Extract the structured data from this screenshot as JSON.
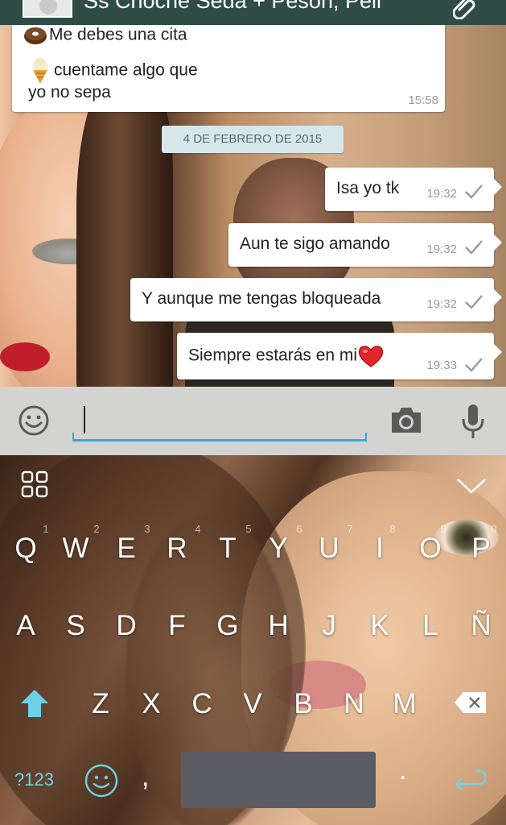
{
  "topbar": {
    "title": "Ss Choche Seda + Peson, Peli"
  },
  "messages": {
    "incoming": {
      "line1_emoji": "donut",
      "line1": "Me debes una cita",
      "line2_emoji": "ice-cream",
      "line2": "cuentame algo que",
      "line3": "yo no sepa",
      "time": "15:58"
    },
    "date": "4 DE FEBRERO DE 2015",
    "outgoing": [
      {
        "text": "Isa yo tk",
        "time": "19:32"
      },
      {
        "text": "Aun te sigo amando",
        "time": "19:32"
      },
      {
        "text": "Y aunque me tengas bloqueada",
        "time": "19:32"
      },
      {
        "text": "Siempre estarás en mi",
        "time": "19:33",
        "emoji": "heart"
      }
    ]
  },
  "compose": {
    "value": "",
    "placeholder": "",
    "accent_color": "#3aa8d8"
  },
  "keyboard": {
    "row1": [
      "Q",
      "W",
      "E",
      "R",
      "T",
      "Y",
      "U",
      "I",
      "O",
      "P"
    ],
    "row1_hints": [
      "1",
      "2",
      "3",
      "4",
      "5",
      "6",
      "7",
      "8",
      "9",
      "0"
    ],
    "row2": [
      "A",
      "S",
      "D",
      "F",
      "G",
      "H",
      "J",
      "K",
      "L",
      "Ñ"
    ],
    "row3": [
      "Z",
      "X",
      "C",
      "V",
      "B",
      "N",
      "M"
    ],
    "symbols_label": "?123",
    "comma": ",",
    "period": ".",
    "accent_color": "#6fd1e6"
  },
  "colors": {
    "topbar": "#2f4c46",
    "bubble": "#ffffff",
    "date_pill": "#d7e6ea",
    "tick": "#9a9a9a",
    "space_key": "#5b5d63"
  }
}
